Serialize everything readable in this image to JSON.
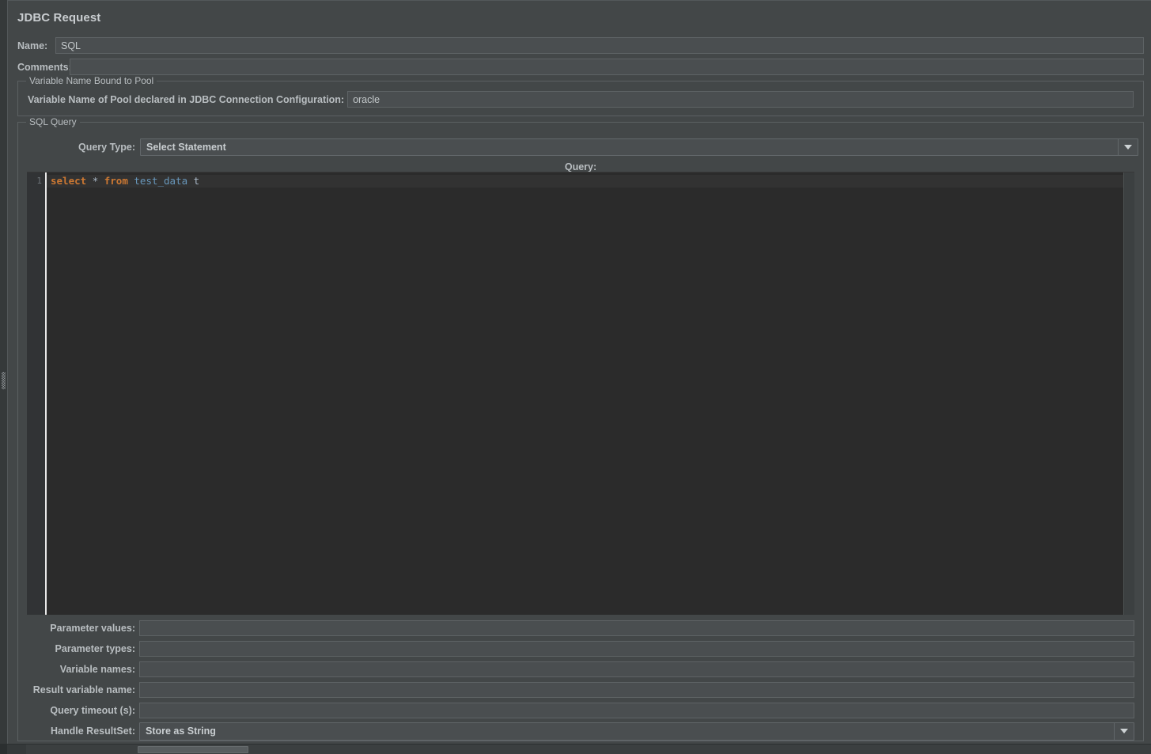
{
  "panel": {
    "title": "JDBC Request"
  },
  "name_row": {
    "label": "Name:",
    "value": "SQL"
  },
  "comments_row": {
    "label": "Comments:",
    "value": ""
  },
  "pool_group": {
    "title": "Variable Name Bound to Pool",
    "field_label": "Variable Name of Pool declared in JDBC Connection Configuration:",
    "value": "oracle"
  },
  "sql_group": {
    "title": "SQL Query",
    "query_type": {
      "label": "Query Type:",
      "value": "Select Statement",
      "arrow_icon": "chevron-down-icon"
    },
    "query_caption": "Query:",
    "editor": {
      "lines": [
        {
          "number": "1",
          "tokens": [
            {
              "text": "select",
              "type": "kw"
            },
            {
              "text": " ",
              "type": "op"
            },
            {
              "text": "*",
              "type": "op"
            },
            {
              "text": " ",
              "type": "op"
            },
            {
              "text": "from",
              "type": "kw"
            },
            {
              "text": " ",
              "type": "op"
            },
            {
              "text": "test_data",
              "type": "id"
            },
            {
              "text": " ",
              "type": "op"
            },
            {
              "text": "t",
              "type": "alias"
            }
          ]
        }
      ]
    },
    "fields": [
      {
        "label": "Parameter values:",
        "value": "",
        "kind": "text"
      },
      {
        "label": "Parameter types:",
        "value": "",
        "kind": "text"
      },
      {
        "label": "Variable names:",
        "value": "",
        "kind": "text"
      },
      {
        "label": "Result variable name:",
        "value": "",
        "kind": "text"
      },
      {
        "label": "Query timeout (s):",
        "value": "",
        "kind": "text"
      },
      {
        "label": "Handle ResultSet:",
        "value": "Store as String",
        "kind": "combo",
        "arrow_icon": "chevron-down-icon"
      }
    ]
  },
  "colors": {
    "panel_bg": "#434748",
    "field_bg": "#4a4e50",
    "editor_bg": "#2b2b2b",
    "label_fg": "#b9bec1",
    "keyword": "#cc7832",
    "identifier": "#6897bb",
    "plain_code": "#a9b7c6"
  },
  "splitter": {
    "handle_icon": "drag-handle-icon"
  },
  "scrollbar": {
    "orientation": "horizontal"
  }
}
